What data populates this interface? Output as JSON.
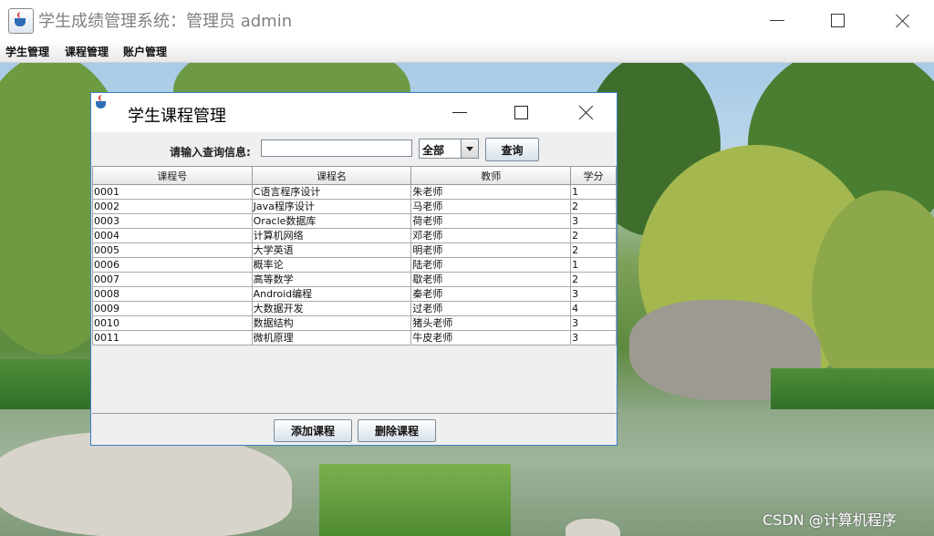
{
  "window": {
    "title": "学生成绩管理系统：管理员 admin",
    "icon": "java-coffee-cup-icon"
  },
  "menubar": {
    "items": [
      "学生管理",
      "课程管理",
      "账户管理"
    ]
  },
  "dialog": {
    "title": "学生课程管理",
    "icon": "java-coffee-cup-icon",
    "search": {
      "label": "请输入查询信息:",
      "value": "",
      "scope": "全部",
      "button": "查询"
    },
    "table": {
      "columns": [
        "课程号",
        "课程名",
        "教师",
        "学分"
      ],
      "rows": [
        [
          "0001",
          "C语言程序设计",
          "朱老师",
          "1"
        ],
        [
          "0002",
          "Java程序设计",
          "马老师",
          "2"
        ],
        [
          "0003",
          "Oracle数据库",
          "荷老师",
          "3"
        ],
        [
          "0004",
          "计算机网络",
          "邓老师",
          "2"
        ],
        [
          "0005",
          "大学英语",
          "明老师",
          "2"
        ],
        [
          "0006",
          "概率论",
          "陆老师",
          "1"
        ],
        [
          "0007",
          "高等数学",
          "歇老师",
          "2"
        ],
        [
          "0008",
          "Android编程",
          "秦老师",
          "3"
        ],
        [
          "0009",
          "大数据开发",
          "过老师",
          "4"
        ],
        [
          "0010",
          "数据结构",
          "猪头老师",
          "3"
        ],
        [
          "0011",
          "微机原理",
          "牛皮老师",
          "3"
        ]
      ]
    },
    "buttons": {
      "add": "添加课程",
      "delete": "删除课程"
    }
  },
  "watermark": "CSDN @计算机程序"
}
